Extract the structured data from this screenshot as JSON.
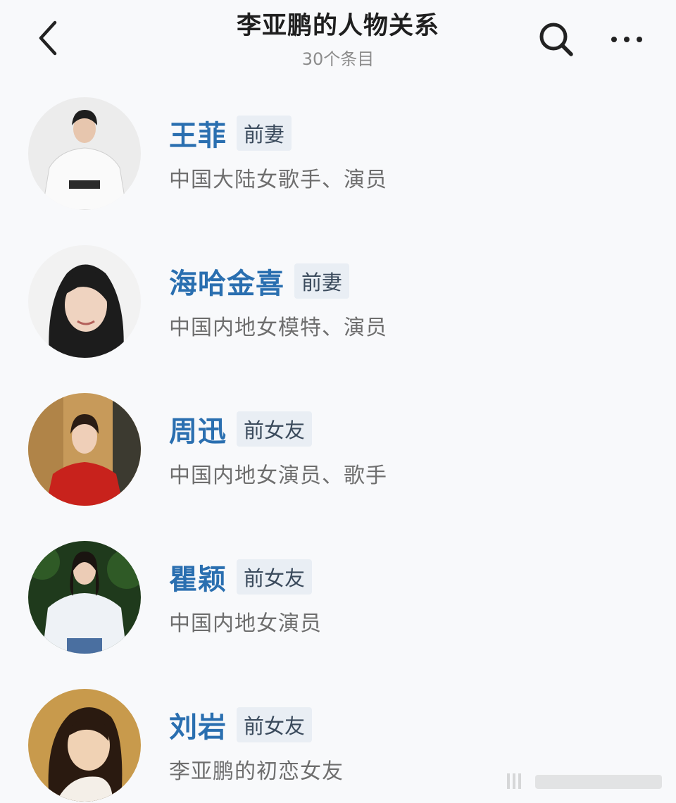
{
  "header": {
    "title": "李亚鹏的人物关系",
    "subtitle": "30个条目",
    "back_icon": "chevron-left-icon",
    "search_icon": "search-icon",
    "more_icon": "more-horizontal-icon"
  },
  "colors": {
    "name": "#2a6fb0",
    "tag_bg": "#e9eef4",
    "background": "#f8f9fb"
  },
  "people": [
    {
      "name": "王菲",
      "tag": "前妻",
      "desc": "中国大陆女歌手、演员"
    },
    {
      "name": "海哈金喜",
      "tag": "前妻",
      "desc": "中国内地女模特、演员"
    },
    {
      "name": "周迅",
      "tag": "前女友",
      "desc": "中国内地女演员、歌手"
    },
    {
      "name": "瞿颖",
      "tag": "前女友",
      "desc": "中国内地女演员"
    },
    {
      "name": "刘岩",
      "tag": "前女友",
      "desc": "李亚鹏的初恋女友"
    }
  ]
}
